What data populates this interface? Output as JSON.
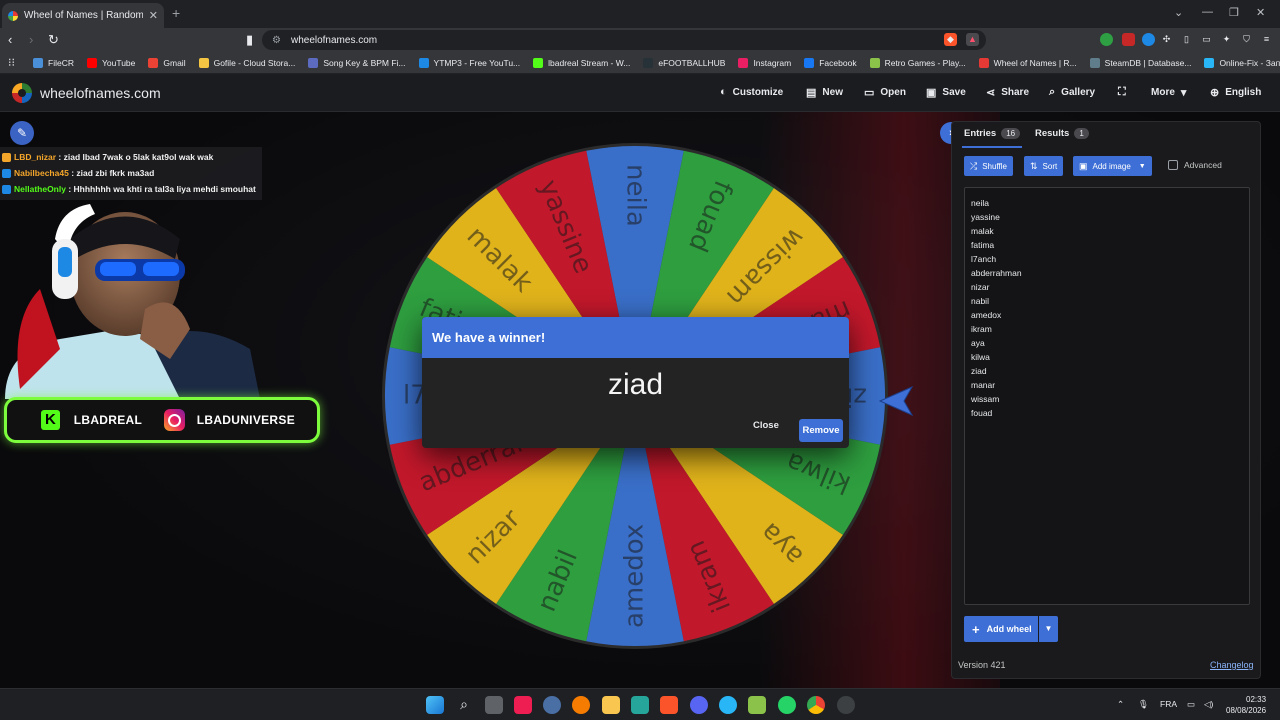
{
  "browser": {
    "tab_title": "Wheel of Names | Random name picker",
    "url": "wheelofnames.com",
    "bookmarks": [
      {
        "label": "FileCR",
        "color": "#4a90d9"
      },
      {
        "label": "YouTube",
        "color": "#ff0000"
      },
      {
        "label": "Gmail",
        "color": "#ea4335"
      },
      {
        "label": "Gofile - Cloud Stora...",
        "color": "#f4c542"
      },
      {
        "label": "Song Key & BPM Fi...",
        "color": "#5c6bc0"
      },
      {
        "label": "YTMP3 - Free YouTu...",
        "color": "#1e88e5"
      },
      {
        "label": "lbadreal Stream - W...",
        "color": "#53fc18"
      },
      {
        "label": "eFOOTBALLHUB",
        "color": "#263238"
      },
      {
        "label": "Instagram",
        "color": "#e91e63"
      },
      {
        "label": "Facebook",
        "color": "#1877f2"
      },
      {
        "label": "Retro Games - Play...",
        "color": "#8bc34a"
      },
      {
        "label": "Wheel of Names | R...",
        "color": "#e53935"
      },
      {
        "label": "SteamDB | Database...",
        "color": "#607d8b"
      },
      {
        "label": "Online-Fix - Запуск...",
        "color": "#29b6f6"
      }
    ]
  },
  "site": {
    "logo": "wheelofnames.com",
    "menu": [
      {
        "label": "Customize",
        "icon": "palette-icon"
      },
      {
        "label": "New",
        "icon": "file-icon"
      },
      {
        "label": "Open",
        "icon": "folder-icon"
      },
      {
        "label": "Save",
        "icon": "save-icon"
      },
      {
        "label": "Share",
        "icon": "share-icon"
      },
      {
        "label": "Gallery",
        "icon": "search-icon"
      },
      {
        "label": "",
        "icon": "fullscreen-icon"
      },
      {
        "label": "More",
        "icon": "chevron-down-icon"
      },
      {
        "label": "English",
        "icon": "globe-icon"
      }
    ]
  },
  "stream": {
    "chat": [
      {
        "user": "LBD_nizar",
        "message": ": ziad lbad 7wak o 5lak kat9ol wak wak",
        "color": "#f4a62a"
      },
      {
        "user": "Nabilbecha45",
        "message": ": ziad zbi fkrk ma3ad",
        "color": "#f4a62a"
      },
      {
        "user": "NellatheOnly",
        "message": ": Hhhhhhh wa khti ra tal3a liya mehdi smouhat",
        "color": "#53fc18"
      }
    ],
    "brand_kick": "LBADREAL",
    "brand_insta": "LBADUNIVERSE"
  },
  "wheel": {
    "names": [
      "neila",
      "fouad",
      "wissam",
      "manar",
      "ziad",
      "kilwa",
      "aya",
      "ikram",
      "amedox",
      "nabil",
      "nizar",
      "abderrahman",
      "l7anch",
      "fatima",
      "malak",
      "yassine"
    ],
    "colors": [
      "#3a6fc9",
      "#2e9e3f",
      "#e0b31b",
      "#c2182b"
    ]
  },
  "dialog": {
    "title": "We have a winner!",
    "winner": "ziad",
    "close_label": "Close",
    "remove_label": "Remove"
  },
  "panel": {
    "tab_entries": "Entries",
    "entries_count": "16",
    "tab_results": "Results",
    "results_count": "1",
    "shuffle": "Shuffle",
    "sort": "Sort",
    "add_image": "Add image",
    "advanced": "Advanced",
    "entries": [
      "neila",
      "yassine",
      "malak",
      "fatima",
      "l7anch",
      "abderrahman",
      "nizar",
      "nabil",
      "amedox",
      "ikram",
      "aya",
      "kilwa",
      "ziad",
      "manar",
      "wissam",
      "fouad"
    ],
    "add_wheel": "Add wheel",
    "version": "Version 421",
    "changelog": "Changelog"
  },
  "taskbar": {
    "lang": "FRA",
    "time": "02:33",
    "date": "08/08/2026"
  }
}
